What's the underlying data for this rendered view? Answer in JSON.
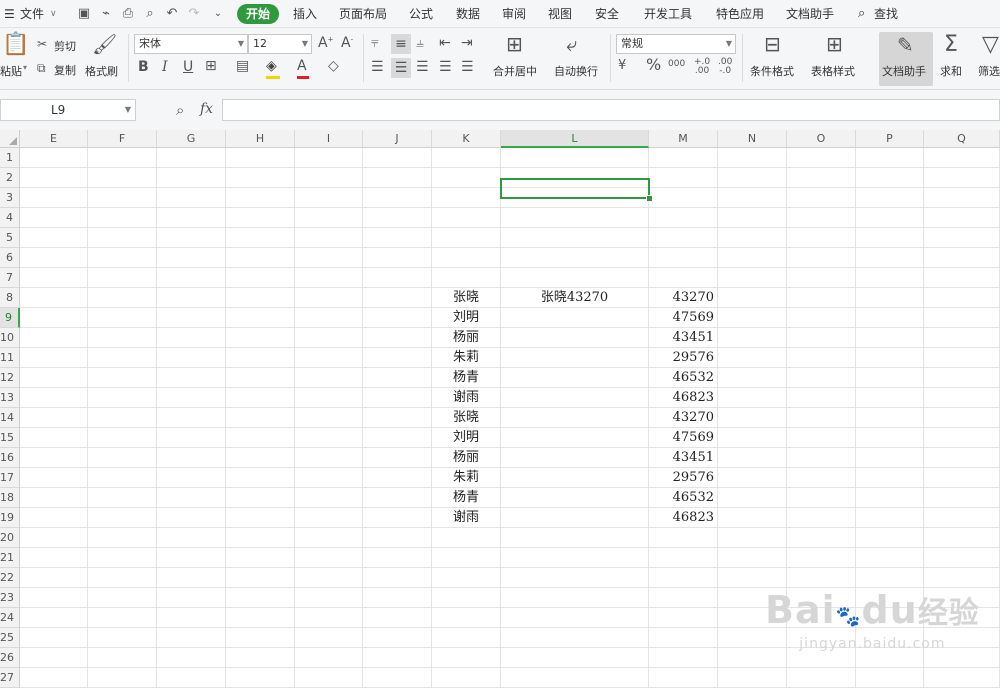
{
  "menu": {
    "file_label": "文件",
    "tabs": [
      "开始",
      "插入",
      "页面布局",
      "公式",
      "数据",
      "审阅",
      "视图",
      "安全",
      "开发工具",
      "特色应用",
      "文档助手"
    ],
    "active_tab": "开始",
    "search_label": "查找"
  },
  "ribbon": {
    "paste_label": "粘贴",
    "cut_label": "剪切",
    "copy_label": "复制",
    "format_painter_label": "格式刷",
    "font_name": "宋体",
    "font_size": "12",
    "bold": "B",
    "italic": "I",
    "underline": "U",
    "merge_center_label": "合并居中",
    "wrap_text_label": "自动换行",
    "number_format": "常规",
    "percent": "%",
    "conditional_format_label": "条件格式",
    "table_style_label": "表格样式",
    "doc_assistant_label": "文档助手",
    "sum_label": "求和",
    "filter_label": "筛选"
  },
  "formula_bar": {
    "cell_ref": "L9",
    "fx": "fx",
    "formula": ""
  },
  "grid": {
    "columns": [
      "E",
      "F",
      "G",
      "H",
      "I",
      "J",
      "K",
      "L",
      "M",
      "N",
      "O",
      "P",
      "Q"
    ],
    "selected_column": "L",
    "selected_row": "9",
    "rows": [
      "1",
      "2",
      "3",
      "4",
      "5",
      "6",
      "7",
      "8",
      "9",
      "10",
      "11",
      "12",
      "13",
      "14",
      "15",
      "16",
      "17",
      "18",
      "19",
      "20",
      "21",
      "22",
      "23",
      "24",
      "25",
      "26",
      "27"
    ],
    "names_col_K": [
      "张晓",
      "刘明",
      "杨丽",
      "朱莉",
      "杨青",
      "谢雨",
      "张晓",
      "刘明",
      "杨丽",
      "朱莉",
      "杨青",
      "谢雨"
    ],
    "col_L": [
      "张晓43270",
      "",
      "",
      "",
      "",
      "",
      "",
      "",
      "",
      "",
      "",
      ""
    ],
    "values_col_M": [
      "43270",
      "47569",
      "43451",
      "29576",
      "46532",
      "46823",
      "43270",
      "47569",
      "43451",
      "29576",
      "46532",
      "46823"
    ],
    "data_start_row": 8
  },
  "watermark": {
    "brand": "Bai",
    "brand2": "du",
    "brand3": "经验",
    "url": "jingyan.baidu.com"
  },
  "colors": {
    "accent": "#2e9a3d",
    "header_bg": "#f2f2f2",
    "ribbon_bg": "#f5f6f7"
  }
}
